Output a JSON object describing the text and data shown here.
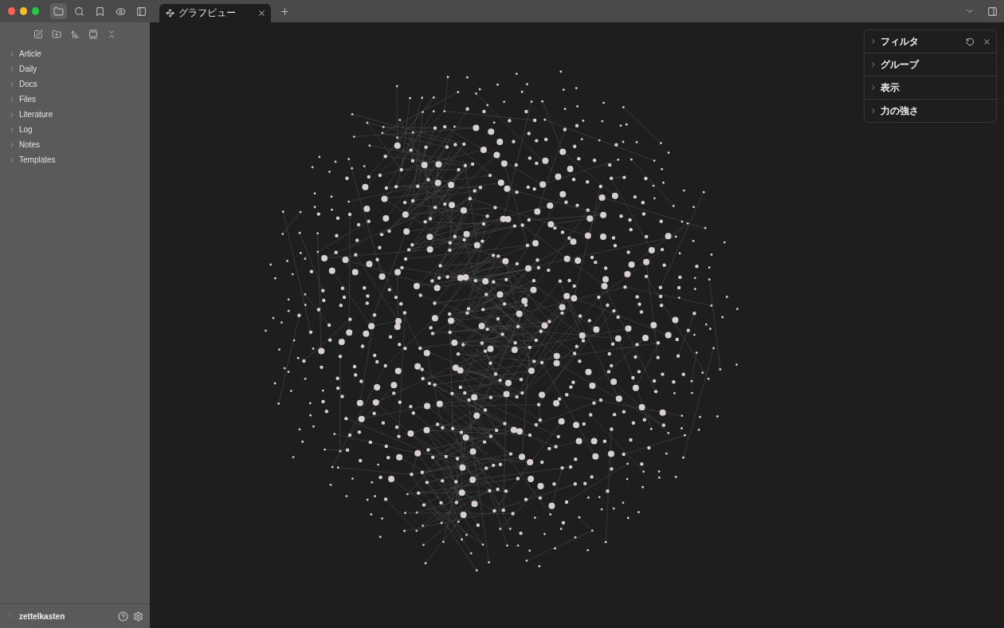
{
  "tabs": [
    {
      "label": "グラフビュー",
      "selected": true
    }
  ],
  "sidebar": {
    "items": [
      {
        "label": "Article",
        "expanded": false
      },
      {
        "label": "Daily",
        "expanded": false
      },
      {
        "label": "Docs",
        "expanded": false
      },
      {
        "label": "Files",
        "expanded": false
      },
      {
        "label": "Literature",
        "expanded": false
      },
      {
        "label": "Log",
        "expanded": false
      },
      {
        "label": "Notes",
        "expanded": false
      },
      {
        "label": "Templates",
        "expanded": false
      }
    ],
    "vault": "zettelkasten"
  },
  "graph_settings": {
    "sections": [
      {
        "label": "フィルタ",
        "expanded": false
      },
      {
        "label": "グループ",
        "expanded": false
      },
      {
        "label": "表示",
        "expanded": false
      },
      {
        "label": "力の強さ",
        "expanded": false
      }
    ]
  }
}
